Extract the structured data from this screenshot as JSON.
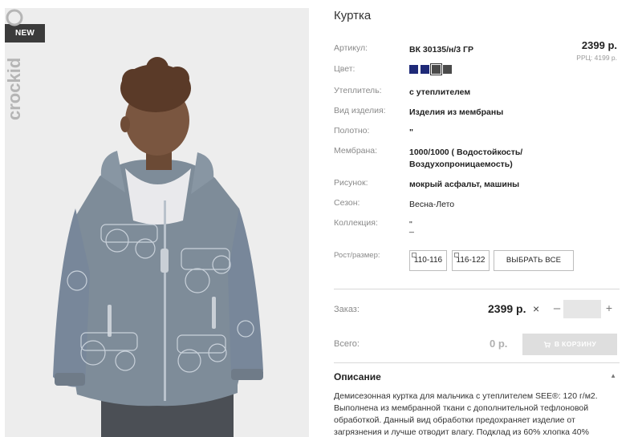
{
  "product": {
    "title": "Куртка",
    "badge": "NEW",
    "brand_logo_text": "crockid",
    "price": "2399 р.",
    "rrc_price": "РРЦ: 4199 р."
  },
  "specs": {
    "article": {
      "label": "Артикул:",
      "value": "ВК 30135/н/3 ГР"
    },
    "color": {
      "label": "Цвет:",
      "swatches": [
        "#1f2a78",
        "#1f2a78",
        "#4a4a4a",
        "#4a4a4a"
      ],
      "selected_index": 2
    },
    "insulation": {
      "label": "Утеплитель:",
      "value": "с утеплителем"
    },
    "item_type": {
      "label": "Вид изделия:",
      "value": "Изделия из мембраны"
    },
    "fabric": {
      "label": "Полотно:",
      "value": "\""
    },
    "membrane": {
      "label": "Мембрана:",
      "value_line1": "1000/1000 ( Водостойкость/",
      "value_line2": "Воздухопроницаемость)"
    },
    "pattern": {
      "label": "Рисунок:",
      "value": "мокрый асфальт, машины"
    },
    "season": {
      "label": "Сезон:",
      "value": "Весна-Лето"
    },
    "collection": {
      "label": "Коллекция:",
      "value_line1": "\"",
      "value_line2": "_"
    },
    "size": {
      "label": "Рост/размер:",
      "options": [
        "110-116",
        "116-122"
      ],
      "select_all": "ВЫБРАТЬ ВСЕ"
    }
  },
  "order": {
    "label": "Заказ:",
    "price": "2399 р.",
    "times": "×",
    "minus": "–",
    "plus": "+",
    "quantity": ""
  },
  "total": {
    "label": "Всего:",
    "value": "0 р.",
    "cart_button": "В КОРЗИНУ"
  },
  "description": {
    "heading": "Описание",
    "chevron": "▲",
    "text": "Демисезонная куртка для мальчика с утеплителем SEE®: 120 г/м2. Выполнена из мембранной ткани с дополнительной тефлоновой обработкой. Данный вид обработки предохраняет изделие от загрязнения и лучше отводит влагу. Подклад из 60% хлопка 40%"
  },
  "colors": {
    "label_gray": "#8a8a8a",
    "photo_bg": "#ededed",
    "jacket": "#7e8c99",
    "disabled_button": "#dedede"
  }
}
